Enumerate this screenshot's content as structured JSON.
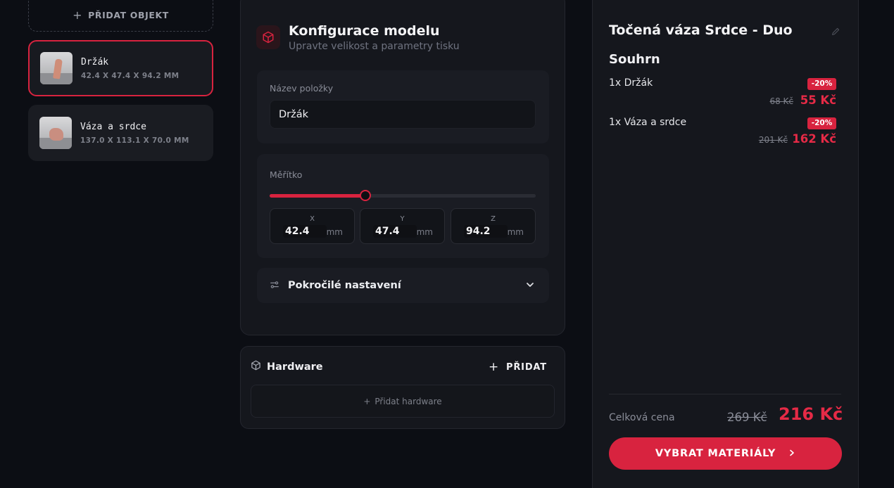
{
  "sidebar": {
    "add_object_label": "PŘIDAT OBJEKT",
    "objects": [
      {
        "name": "Držák",
        "dims": "42.4 X 47.4 X 94.2 MM",
        "selected": true
      },
      {
        "name": "Váza a srdce",
        "dims": "137.0 X 113.1 X 70.0 MM",
        "selected": false
      }
    ]
  },
  "config": {
    "title": "Konfigurace modelu",
    "subtitle": "Upravte velikost a parametry tisku",
    "name_label": "Název položky",
    "name_value": "Držák",
    "scale_label": "Měřítko",
    "scale_fraction": 0.36,
    "dims": [
      {
        "axis": "X",
        "value": "42.4",
        "unit": "mm"
      },
      {
        "axis": "Y",
        "value": "47.4",
        "unit": "mm"
      },
      {
        "axis": "Z",
        "value": "94.2",
        "unit": "mm"
      }
    ],
    "advanced_label": "Pokročilé nastavení"
  },
  "hardware": {
    "title": "Hardware",
    "add_label": "PŘIDAT",
    "add_hardware_label": "Přidat hardware"
  },
  "summary": {
    "product_title": "Točená váza Srdce - Duo",
    "section_title": "Souhrn",
    "items": [
      {
        "name": "1x Držák",
        "discount": "-20%",
        "old_price": "68 Kč",
        "new_price": "55 Kč"
      },
      {
        "name": "1x Váza a srdce",
        "discount": "-20%",
        "old_price": "201 Kč",
        "new_price": "162 Kč"
      }
    ],
    "total_label": "Celková cena",
    "total_old": "269 Kč",
    "total_new": "216 Kč",
    "cta_label": "VYBRAT MATERIÁLY"
  },
  "colors": {
    "accent": "#d8233f",
    "background": "#0c0e14",
    "panel": "#15171d"
  },
  "icons": {
    "add_object": "plus-icon",
    "config": "cube-icon",
    "advanced": "sliders-icon",
    "expand": "chevron-down-icon",
    "hardware": "package-icon",
    "edit_title": "pencil-icon",
    "cta": "chevron-right-icon"
  }
}
